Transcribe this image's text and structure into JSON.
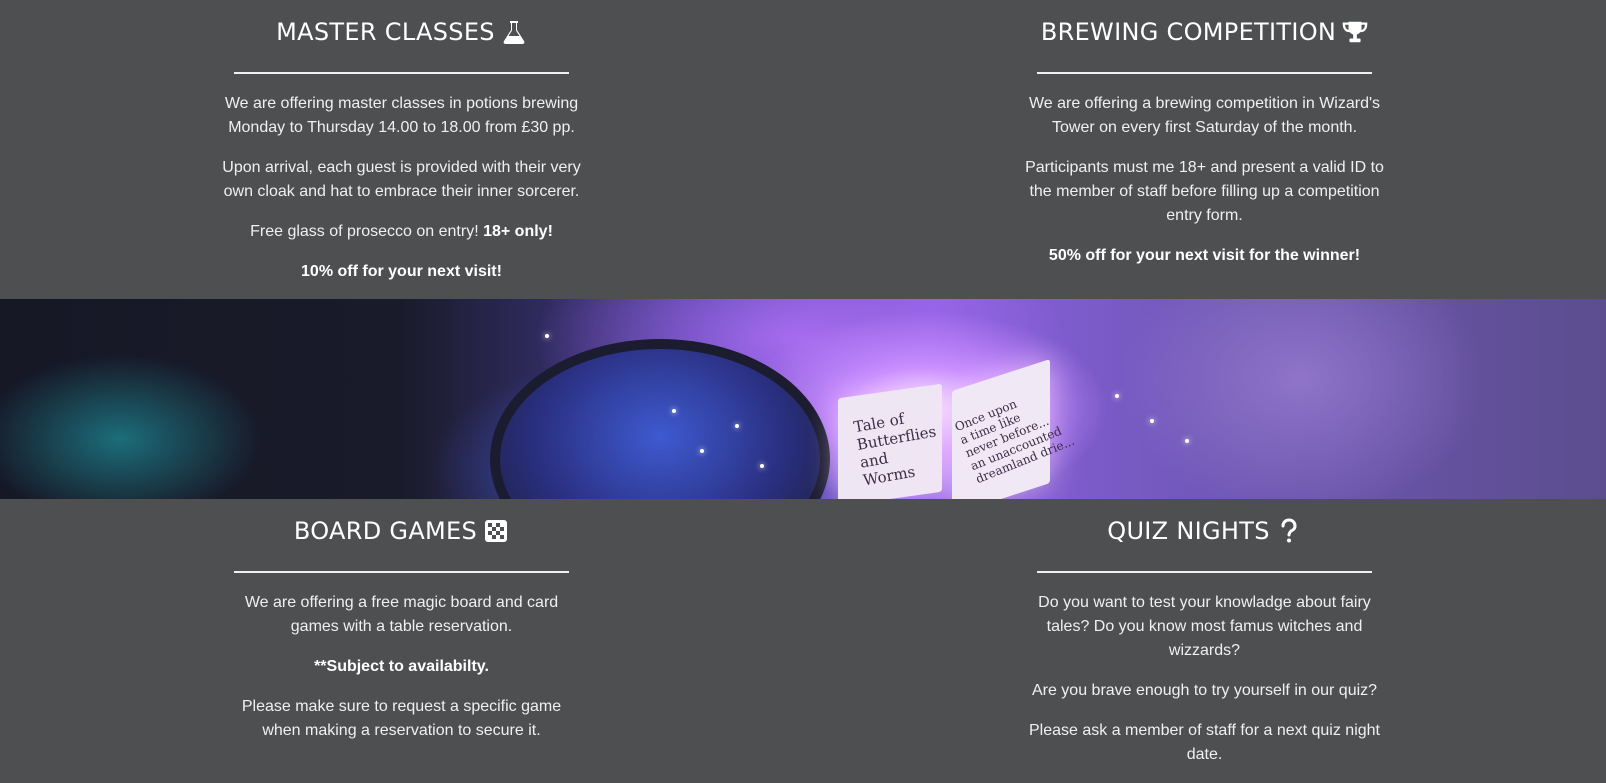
{
  "top": {
    "master": {
      "title": "MASTER CLASSES",
      "icon": "flask-icon",
      "p1": "We are offering master classes in potions brewing Monday to Thursday 14.00 to 18.00 from £30 pp.",
      "p2": "Upon arrival, each guest is provided with their very own cloak and hat to embrace their inner sorcerer.",
      "p3_text": "Free glass of prosecco on entry! ",
      "p3_bold": "18+ only!",
      "p4": "10% off for your next visit!"
    },
    "brewing": {
      "title": "BREWING COMPETITION",
      "icon": "trophy-icon",
      "p1": "We are offering a brewing competition in Wizard's Tower on every first Saturday of the month.",
      "p2": "Participants must me 18+ and present a valid ID to the member of staff before filling up a competition entry form.",
      "p3": "50% off for your next visit for the winner!"
    }
  },
  "banner": {
    "book_left": "Tale of\nButterflies\nand\nWorms",
    "book_right": "Once upon\na time like\nnever before...\nan unaccounted\ndreamland drie..."
  },
  "bottom": {
    "board": {
      "title": "BOARD GAMES",
      "icon": "checkerboard-icon",
      "p1": "We are offering a free magic board and card games with a table reservation.",
      "p2": "**Subject to availabilty.",
      "p3": "Please make sure to request a specific game when making a reservation to secure it."
    },
    "quiz": {
      "title": "QUIZ NIGHTS",
      "icon": "question-icon",
      "p1": "Do you want to test your knowladge about fairy tales? Do you know most famus witches and wizzards?",
      "p2": "Are you brave enough to try yourself in our quiz?",
      "p3": "Please ask a member of staff for a next quiz night date."
    }
  }
}
